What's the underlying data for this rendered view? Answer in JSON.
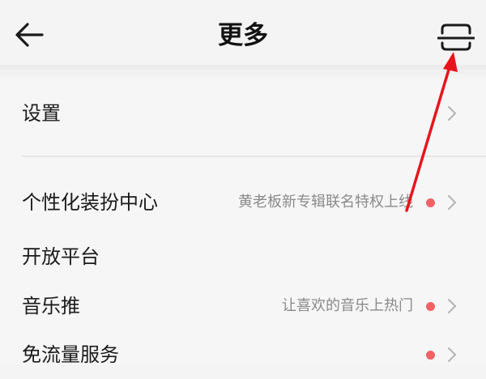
{
  "header": {
    "title": "更多",
    "back_icon": "back-arrow-icon",
    "scan_icon": "scan-icon"
  },
  "menu": [
    {
      "label": "设置",
      "subtitle": "",
      "badge": false
    },
    {
      "label": "个性化装扮中心",
      "subtitle": "黄老板新专辑联名特权上线",
      "badge": true
    },
    {
      "label": "开放平台",
      "subtitle": "",
      "badge": false
    },
    {
      "label": "音乐推",
      "subtitle": "让喜欢的音乐上热门",
      "badge": true
    },
    {
      "label": "免流量服务",
      "subtitle": "",
      "badge": true
    }
  ],
  "colors": {
    "badge": "#f16166",
    "annotation_arrow": "#e8141c",
    "background": "#f4f4f4"
  }
}
